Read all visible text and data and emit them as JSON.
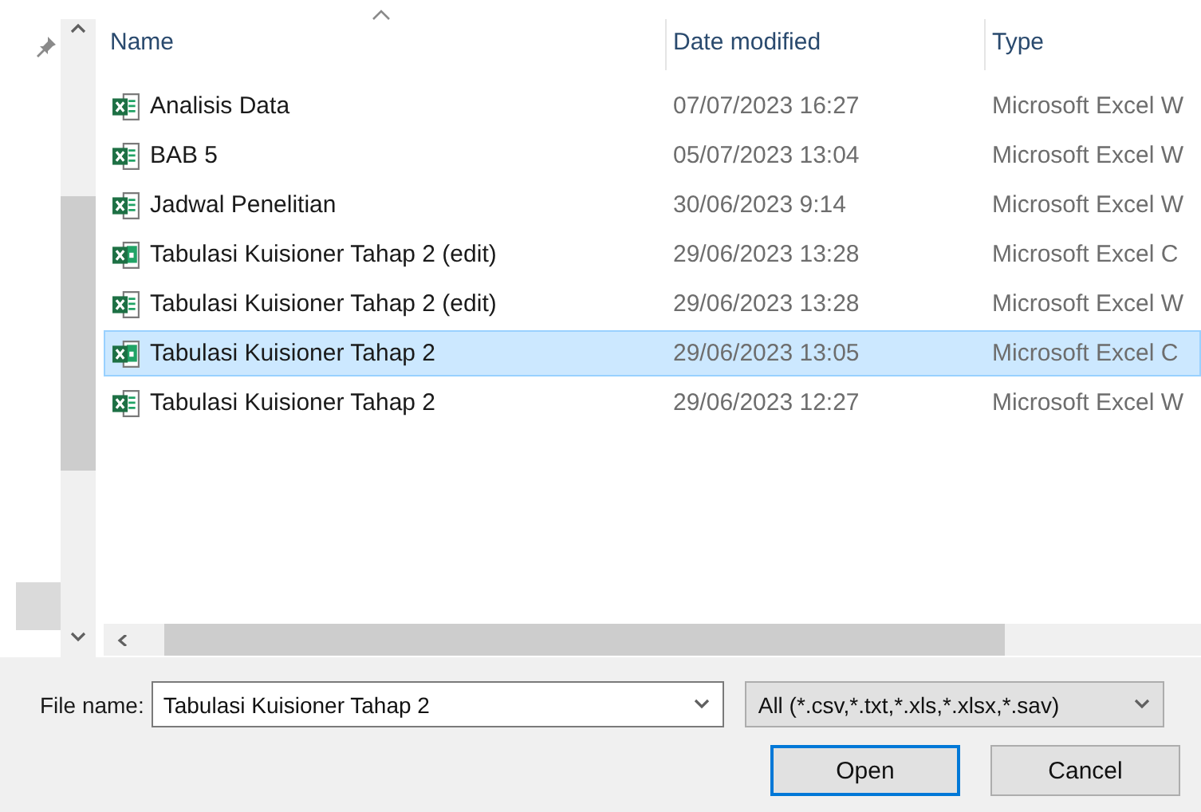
{
  "columns": [
    {
      "label": "Name",
      "sorted": true
    },
    {
      "label": "Date modified",
      "sorted": false
    },
    {
      "label": "Type",
      "sorted": false
    }
  ],
  "files": [
    {
      "name": "Analisis Data",
      "date": "07/07/2023 16:27",
      "type": "Microsoft Excel W",
      "kind": "workbook",
      "selected": false
    },
    {
      "name": "BAB 5",
      "date": "05/07/2023 13:04",
      "type": "Microsoft Excel W",
      "kind": "workbook",
      "selected": false
    },
    {
      "name": "Jadwal Penelitian",
      "date": "30/06/2023 9:14",
      "type": "Microsoft Excel W",
      "kind": "workbook",
      "selected": false
    },
    {
      "name": "Tabulasi Kuisioner Tahap 2 (edit)",
      "date": "29/06/2023 13:28",
      "type": "Microsoft Excel C",
      "kind": "csv",
      "selected": false
    },
    {
      "name": "Tabulasi Kuisioner Tahap 2 (edit)",
      "date": "29/06/2023 13:28",
      "type": "Microsoft Excel W",
      "kind": "workbook",
      "selected": false
    },
    {
      "name": "Tabulasi Kuisioner Tahap 2",
      "date": "29/06/2023 13:05",
      "type": "Microsoft Excel C",
      "kind": "csv",
      "selected": true
    },
    {
      "name": "Tabulasi Kuisioner Tahap 2",
      "date": "29/06/2023 12:27",
      "type": "Microsoft Excel W",
      "kind": "workbook",
      "selected": false
    }
  ],
  "file_name": {
    "label": "File name:",
    "value": "Tabulasi Kuisioner Tahap 2"
  },
  "filter": {
    "value": "All (*.csv,*.txt,*.xls,*.xlsx,*.sav)"
  },
  "buttons": [
    {
      "label": "Open",
      "default": true
    },
    {
      "label": "Cancel",
      "default": false
    }
  ]
}
